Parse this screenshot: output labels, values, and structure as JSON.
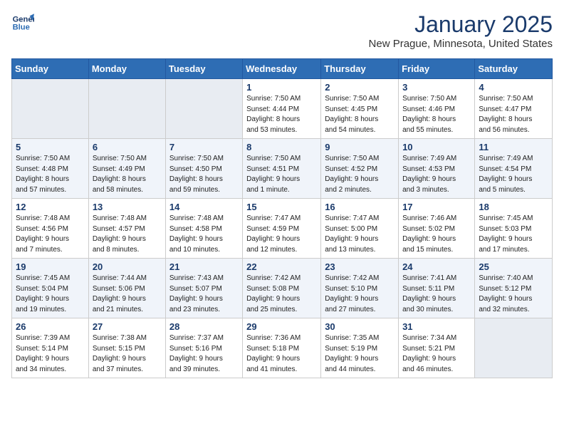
{
  "logo": {
    "line1": "General",
    "line2": "Blue"
  },
  "title": "January 2025",
  "subtitle": "New Prague, Minnesota, United States",
  "weekdays": [
    "Sunday",
    "Monday",
    "Tuesday",
    "Wednesday",
    "Thursday",
    "Friday",
    "Saturday"
  ],
  "weeks": [
    [
      {
        "day": "",
        "info": ""
      },
      {
        "day": "",
        "info": ""
      },
      {
        "day": "",
        "info": ""
      },
      {
        "day": "1",
        "info": "Sunrise: 7:50 AM\nSunset: 4:44 PM\nDaylight: 8 hours\nand 53 minutes."
      },
      {
        "day": "2",
        "info": "Sunrise: 7:50 AM\nSunset: 4:45 PM\nDaylight: 8 hours\nand 54 minutes."
      },
      {
        "day": "3",
        "info": "Sunrise: 7:50 AM\nSunset: 4:46 PM\nDaylight: 8 hours\nand 55 minutes."
      },
      {
        "day": "4",
        "info": "Sunrise: 7:50 AM\nSunset: 4:47 PM\nDaylight: 8 hours\nand 56 minutes."
      }
    ],
    [
      {
        "day": "5",
        "info": "Sunrise: 7:50 AM\nSunset: 4:48 PM\nDaylight: 8 hours\nand 57 minutes."
      },
      {
        "day": "6",
        "info": "Sunrise: 7:50 AM\nSunset: 4:49 PM\nDaylight: 8 hours\nand 58 minutes."
      },
      {
        "day": "7",
        "info": "Sunrise: 7:50 AM\nSunset: 4:50 PM\nDaylight: 8 hours\nand 59 minutes."
      },
      {
        "day": "8",
        "info": "Sunrise: 7:50 AM\nSunset: 4:51 PM\nDaylight: 9 hours\nand 1 minute."
      },
      {
        "day": "9",
        "info": "Sunrise: 7:50 AM\nSunset: 4:52 PM\nDaylight: 9 hours\nand 2 minutes."
      },
      {
        "day": "10",
        "info": "Sunrise: 7:49 AM\nSunset: 4:53 PM\nDaylight: 9 hours\nand 3 minutes."
      },
      {
        "day": "11",
        "info": "Sunrise: 7:49 AM\nSunset: 4:54 PM\nDaylight: 9 hours\nand 5 minutes."
      }
    ],
    [
      {
        "day": "12",
        "info": "Sunrise: 7:48 AM\nSunset: 4:56 PM\nDaylight: 9 hours\nand 7 minutes."
      },
      {
        "day": "13",
        "info": "Sunrise: 7:48 AM\nSunset: 4:57 PM\nDaylight: 9 hours\nand 8 minutes."
      },
      {
        "day": "14",
        "info": "Sunrise: 7:48 AM\nSunset: 4:58 PM\nDaylight: 9 hours\nand 10 minutes."
      },
      {
        "day": "15",
        "info": "Sunrise: 7:47 AM\nSunset: 4:59 PM\nDaylight: 9 hours\nand 12 minutes."
      },
      {
        "day": "16",
        "info": "Sunrise: 7:47 AM\nSunset: 5:00 PM\nDaylight: 9 hours\nand 13 minutes."
      },
      {
        "day": "17",
        "info": "Sunrise: 7:46 AM\nSunset: 5:02 PM\nDaylight: 9 hours\nand 15 minutes."
      },
      {
        "day": "18",
        "info": "Sunrise: 7:45 AM\nSunset: 5:03 PM\nDaylight: 9 hours\nand 17 minutes."
      }
    ],
    [
      {
        "day": "19",
        "info": "Sunrise: 7:45 AM\nSunset: 5:04 PM\nDaylight: 9 hours\nand 19 minutes."
      },
      {
        "day": "20",
        "info": "Sunrise: 7:44 AM\nSunset: 5:06 PM\nDaylight: 9 hours\nand 21 minutes."
      },
      {
        "day": "21",
        "info": "Sunrise: 7:43 AM\nSunset: 5:07 PM\nDaylight: 9 hours\nand 23 minutes."
      },
      {
        "day": "22",
        "info": "Sunrise: 7:42 AM\nSunset: 5:08 PM\nDaylight: 9 hours\nand 25 minutes."
      },
      {
        "day": "23",
        "info": "Sunrise: 7:42 AM\nSunset: 5:10 PM\nDaylight: 9 hours\nand 27 minutes."
      },
      {
        "day": "24",
        "info": "Sunrise: 7:41 AM\nSunset: 5:11 PM\nDaylight: 9 hours\nand 30 minutes."
      },
      {
        "day": "25",
        "info": "Sunrise: 7:40 AM\nSunset: 5:12 PM\nDaylight: 9 hours\nand 32 minutes."
      }
    ],
    [
      {
        "day": "26",
        "info": "Sunrise: 7:39 AM\nSunset: 5:14 PM\nDaylight: 9 hours\nand 34 minutes."
      },
      {
        "day": "27",
        "info": "Sunrise: 7:38 AM\nSunset: 5:15 PM\nDaylight: 9 hours\nand 37 minutes."
      },
      {
        "day": "28",
        "info": "Sunrise: 7:37 AM\nSunset: 5:16 PM\nDaylight: 9 hours\nand 39 minutes."
      },
      {
        "day": "29",
        "info": "Sunrise: 7:36 AM\nSunset: 5:18 PM\nDaylight: 9 hours\nand 41 minutes."
      },
      {
        "day": "30",
        "info": "Sunrise: 7:35 AM\nSunset: 5:19 PM\nDaylight: 9 hours\nand 44 minutes."
      },
      {
        "day": "31",
        "info": "Sunrise: 7:34 AM\nSunset: 5:21 PM\nDaylight: 9 hours\nand 46 minutes."
      },
      {
        "day": "",
        "info": ""
      }
    ]
  ]
}
